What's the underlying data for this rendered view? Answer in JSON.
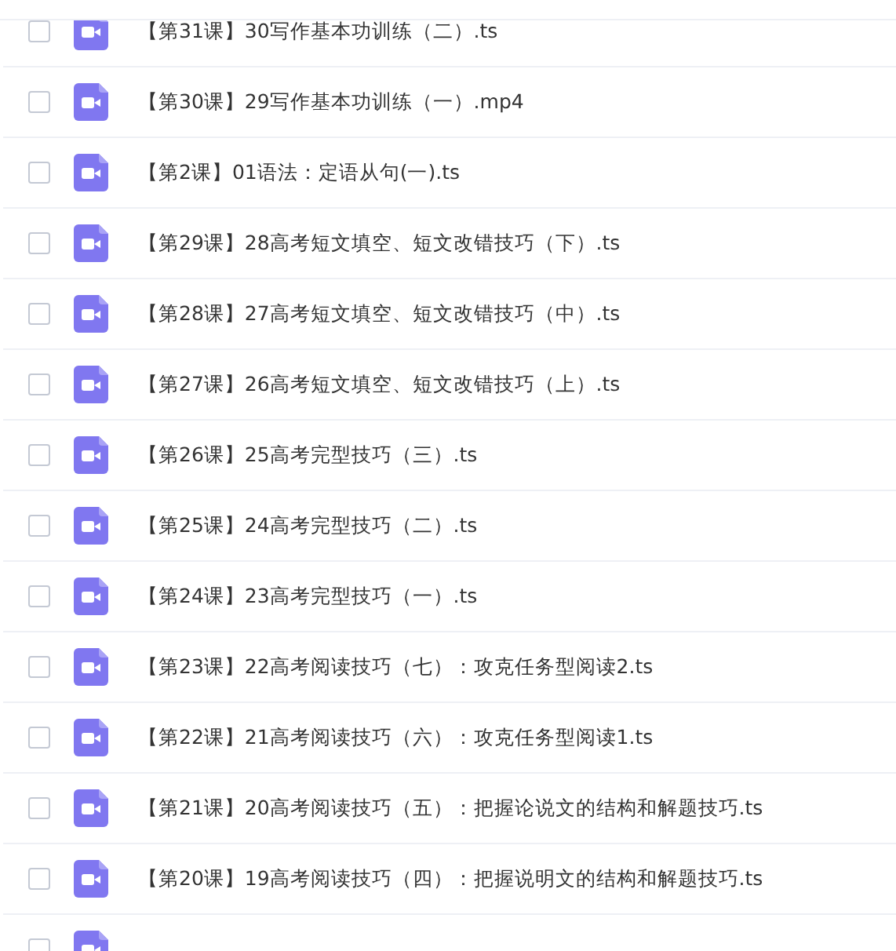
{
  "files": [
    {
      "name": "【第31课】30写作基本功训练（二）.ts",
      "checked": false
    },
    {
      "name": "【第30课】29写作基本功训练（一）.mp4",
      "checked": false
    },
    {
      "name": "【第2课】01语法：定语从句(一).ts",
      "checked": false
    },
    {
      "name": "【第29课】28高考短文填空、短文改错技巧（下）.ts",
      "checked": false
    },
    {
      "name": "【第28课】27高考短文填空、短文改错技巧（中）.ts",
      "checked": false
    },
    {
      "name": "【第27课】26高考短文填空、短文改错技巧（上）.ts",
      "checked": false
    },
    {
      "name": "【第26课】25高考完型技巧（三）.ts",
      "checked": false
    },
    {
      "name": "【第25课】24高考完型技巧（二）.ts",
      "checked": false
    },
    {
      "name": "【第24课】23高考完型技巧（一）.ts",
      "checked": false
    },
    {
      "name": "【第23课】22高考阅读技巧（七）：攻克任务型阅读2.ts",
      "checked": false
    },
    {
      "name": "【第22课】21高考阅读技巧（六）：攻克任务型阅读1.ts",
      "checked": false
    },
    {
      "name": "【第21课】20高考阅读技巧（五）：把握论说文的结构和解题技巧.ts",
      "checked": false
    },
    {
      "name": "【第20课】19高考阅读技巧（四）：把握说明文的结构和解题技巧.ts",
      "checked": false
    },
    {
      "checked": false
    }
  ]
}
